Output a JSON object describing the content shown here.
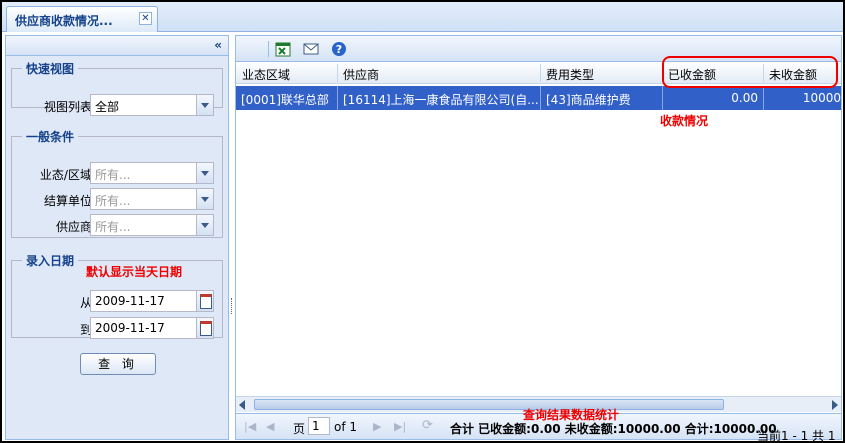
{
  "tab": {
    "title": "供应商收款情况...",
    "close": "✕"
  },
  "left": {
    "collapse": "«",
    "quick_view": {
      "legend": "快速视图",
      "view_list_label": "视图列表:",
      "view_list_value": "全部"
    },
    "general": {
      "legend": "一般条件",
      "region_label": "业态/区域:",
      "region_placeholder": "所有...",
      "settle_label": "结算单位:",
      "settle_placeholder": "所有...",
      "supplier_label": "供应商:",
      "supplier_placeholder": "所有..."
    },
    "entry_date": {
      "legend": "录入日期",
      "from_label": "从:",
      "from_value": "2009-11-17",
      "to_label": "到:",
      "to_value": "2009-11-17"
    },
    "query_button": "查 询"
  },
  "grid": {
    "columns": [
      "业态区域",
      "供应商",
      "费用类型",
      "已收金额",
      "未收金额"
    ],
    "rows": [
      [
        "[0001]联华总部",
        "[16114]上海一康食品有限公司(自...",
        "[43]商品维护费",
        "0.00",
        "10000"
      ]
    ]
  },
  "pager": {
    "page_label": "页",
    "page_value": "1",
    "of_label": "of 1",
    "summary": "合计 已收金额:0.00  未收金额:10000.00  合计:10000.00",
    "display": "当前1 - 1 共 1"
  },
  "annotations": {
    "default_date": "默认显示当天日期",
    "receipt_status": "收款情况",
    "stats": "查询结果数据统计"
  },
  "colors": {
    "accent": "#15428b",
    "selection": "#3160c9",
    "annotation": "#e00000"
  }
}
